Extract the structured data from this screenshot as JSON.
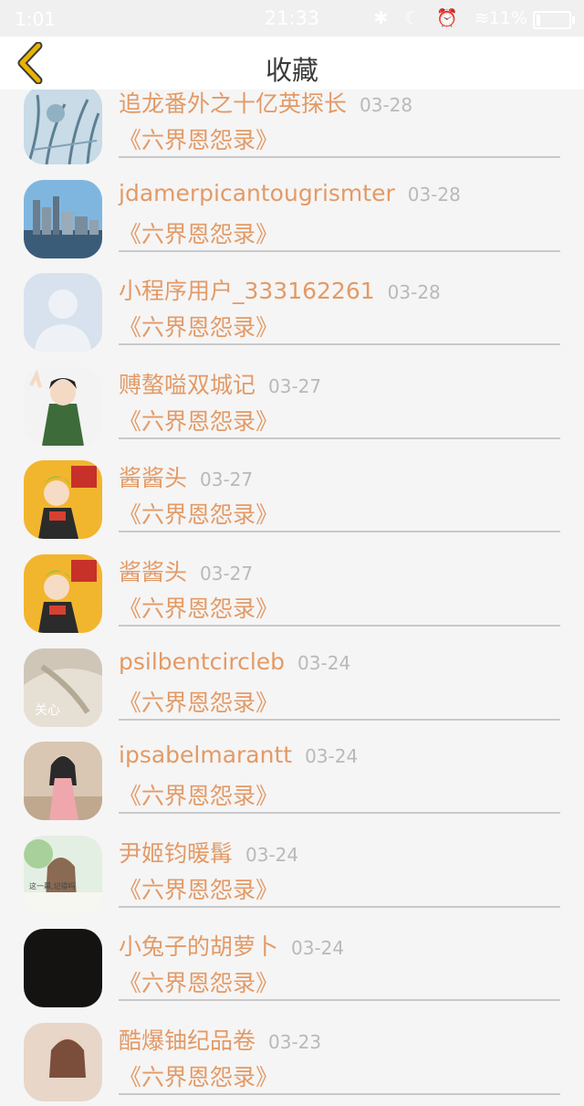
{
  "status_bar": {
    "left_text": "1:01",
    "time": "21:33",
    "icons": "✱ ☾ ⏰ ≋",
    "battery": "11%",
    "battery_level": 0.11
  },
  "header": {
    "back_icon": "chevron-left-icon",
    "title": "收藏"
  },
  "colors": {
    "accent": "#e39a66",
    "date": "#b9b9b9",
    "back_icon": "#e8b400"
  },
  "items": [
    {
      "name": "追龙番外之十亿英探长",
      "date": "03-28",
      "book": "《六界恩怨录》",
      "avatar": "plant-sketch-avatar"
    },
    {
      "name": "jdamerpicantougrismter",
      "date": "03-28",
      "book": "《六界恩怨录》",
      "avatar": "city-skyline-avatar"
    },
    {
      "name": "小程序用户_333162261",
      "date": "03-28",
      "book": "《六界恩怨录》",
      "avatar": "default-user-avatar"
    },
    {
      "name": "赙螯嗌双城记",
      "date": "03-27",
      "book": "《六界恩怨录》",
      "avatar": "anime-boy-avatar"
    },
    {
      "name": "酱酱头",
      "date": "03-27",
      "book": "《六界恩怨录》",
      "avatar": "anime-green-hair-avatar"
    },
    {
      "name": "酱酱头",
      "date": "03-27",
      "book": "《六界恩怨录》",
      "avatar": "anime-green-hair-avatar"
    },
    {
      "name": "psilbentcircleb",
      "date": "03-24",
      "book": "《六界恩怨录》",
      "avatar": "soft-photo-avatar",
      "avatar_text": "关心"
    },
    {
      "name": "ipsabelmarantt",
      "date": "03-24",
      "book": "《六界恩怨录》",
      "avatar": "girl-photo-avatar"
    },
    {
      "name": "尹姬钧暖髯",
      "date": "03-24",
      "book": "《六界恩怨录》",
      "avatar": "girl-green-avatar"
    },
    {
      "name": "小兔子的胡萝卜",
      "date": "03-24",
      "book": "《六界恩怨录》",
      "avatar": "black-avatar"
    },
    {
      "name": "酷爆铀纪品卷",
      "date": "03-23",
      "book": "《六界恩怨录》",
      "avatar": "girl-partial-avatar"
    }
  ]
}
